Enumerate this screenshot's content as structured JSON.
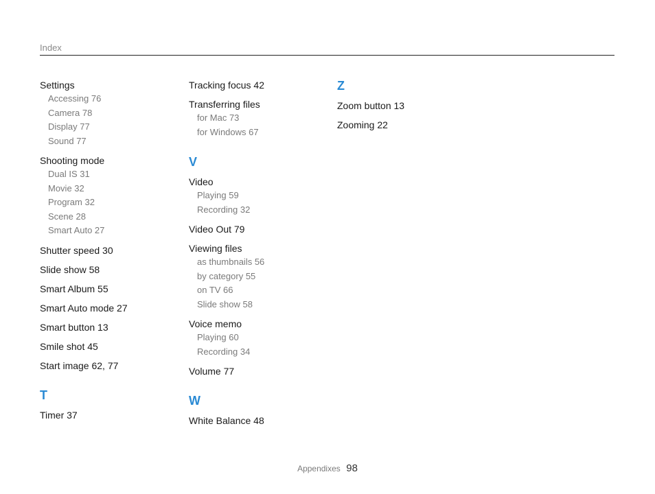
{
  "header": {
    "label": "Index"
  },
  "columns": [
    {
      "blocks": [
        {
          "entries": [
            {
              "main": "Settings",
              "subs": [
                "Accessing  76",
                "Camera  78",
                "Display  77",
                "Sound  77"
              ]
            },
            {
              "main": "Shooting mode",
              "subs": [
                "Dual IS  31",
                "Movie  32",
                "Program  32",
                "Scene  28",
                "Smart Auto  27"
              ]
            },
            {
              "main": "Shutter speed  30",
              "subs": []
            },
            {
              "main": "Slide show  58",
              "subs": []
            },
            {
              "main": "Smart Album  55",
              "subs": []
            },
            {
              "main": "Smart Auto mode  27",
              "subs": []
            },
            {
              "main": "Smart button  13",
              "subs": []
            },
            {
              "main": "Smile shot  45",
              "subs": []
            },
            {
              "main": "Start image  62, 77",
              "subs": []
            }
          ]
        },
        {
          "letter": "T",
          "entries": [
            {
              "main": "Timer  37",
              "subs": []
            }
          ]
        }
      ]
    },
    {
      "blocks": [
        {
          "entries": [
            {
              "main": "Tracking focus  42",
              "subs": []
            },
            {
              "main": "Transferring files",
              "subs": [
                "for Mac  73",
                "for Windows  67"
              ]
            }
          ]
        },
        {
          "letter": "V",
          "entries": [
            {
              "main": "Video",
              "subs": [
                "Playing  59",
                "Recording  32"
              ]
            },
            {
              "main": "Video Out  79",
              "subs": []
            },
            {
              "main": "Viewing files",
              "subs": [
                "as thumbnails  56",
                "by category  55",
                "on TV  66",
                "Slide show  58"
              ]
            },
            {
              "main": "Voice memo",
              "subs": [
                "Playing  60",
                "Recording  34"
              ]
            },
            {
              "main": "Volume  77",
              "subs": []
            }
          ]
        },
        {
          "letter": "W",
          "entries": [
            {
              "main": "White Balance  48",
              "subs": []
            }
          ]
        }
      ]
    },
    {
      "blocks": [
        {
          "letter": "Z",
          "entries": [
            {
              "main": "Zoom button  13",
              "subs": []
            },
            {
              "main": "Zooming  22",
              "subs": []
            }
          ]
        }
      ]
    }
  ],
  "footer": {
    "label": "Appendixes",
    "page": "98"
  },
  "colors": {
    "letter_accent": "#2a8ad4",
    "rule": "#222222",
    "sub_text": "#7a7a7a"
  }
}
